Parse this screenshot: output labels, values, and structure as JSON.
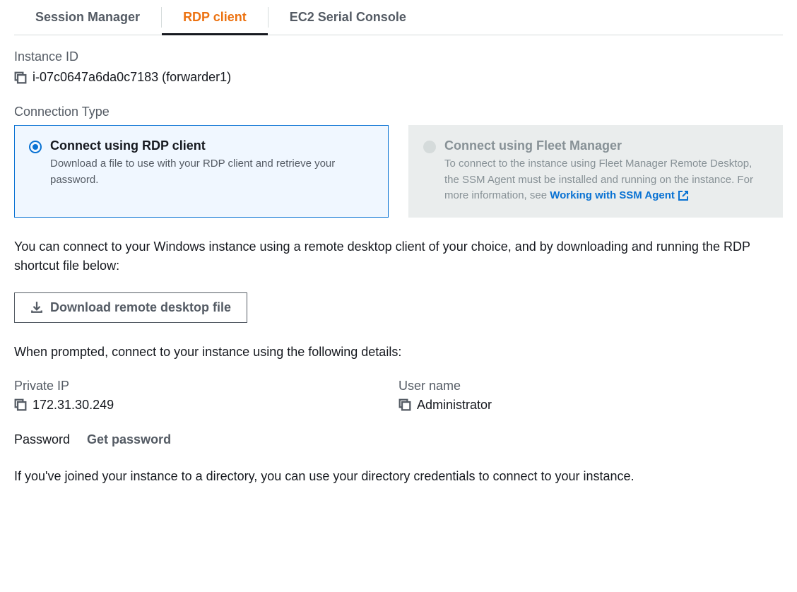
{
  "tabs": {
    "session_manager": "Session Manager",
    "rdp_client": "RDP client",
    "ec2_serial": "EC2 Serial Console"
  },
  "instance": {
    "label": "Instance ID",
    "value": "i-07c0647a6da0c7183 (forwarder1)"
  },
  "connection_type": {
    "label": "Connection Type",
    "rdp": {
      "title": "Connect using RDP client",
      "desc": "Download a file to use with your RDP client and retrieve your password."
    },
    "fleet": {
      "title": "Connect using Fleet Manager",
      "desc_pre": "To connect to the instance using Fleet Manager Remote Desktop, the SSM Agent must be installed and running on the instance. For more information, see ",
      "link": "Working with SSM Agent"
    }
  },
  "intro_text": "You can connect to your Windows instance using a remote desktop client of your choice, and by downloading and running the RDP shortcut file below:",
  "download_button": "Download remote desktop file",
  "prompt_text": "When prompted, connect to your instance using the following details:",
  "details": {
    "private_ip": {
      "label": "Private IP",
      "value": "172.31.30.249"
    },
    "user_name": {
      "label": "User name",
      "value": "Administrator"
    }
  },
  "password": {
    "label": "Password",
    "action": "Get password"
  },
  "directory_text": "If you've joined your instance to a directory, you can use your directory credentials to connect to your instance."
}
